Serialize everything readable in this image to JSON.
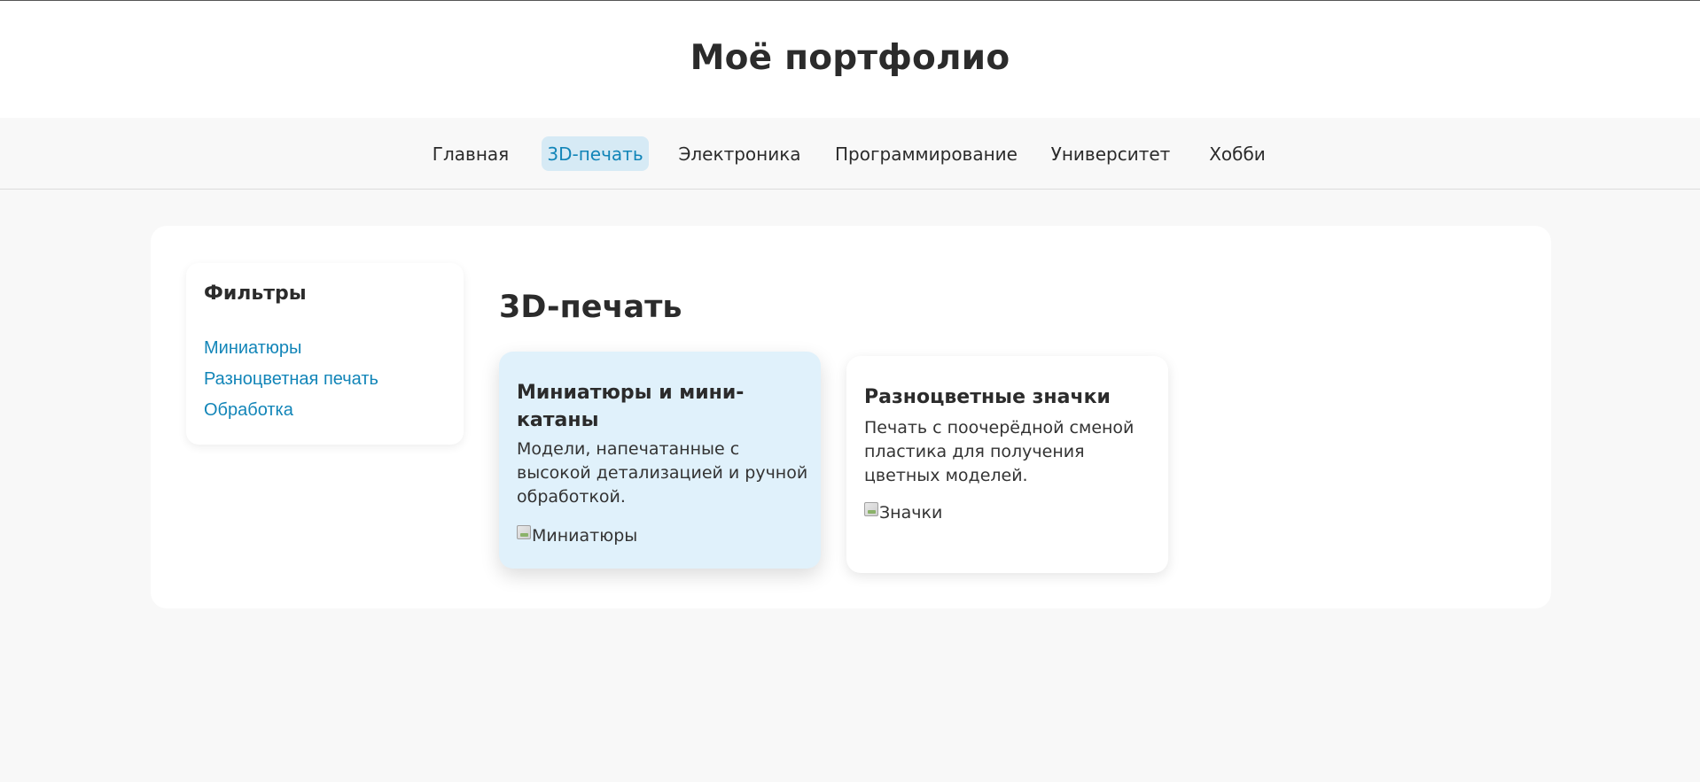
{
  "header": {
    "title": "Моё портфолио"
  },
  "nav": {
    "items": [
      {
        "label": "Главная",
        "active": false
      },
      {
        "label": "3D-печать",
        "active": true
      },
      {
        "label": "Электроника",
        "active": false
      },
      {
        "label": "Программирование",
        "active": false
      },
      {
        "label": "Университет",
        "active": false
      },
      {
        "label": "Хобби",
        "active": false
      }
    ]
  },
  "filters": {
    "title": "Фильтры",
    "links": [
      "Миниатюры",
      "Разноцветная печать",
      "Обработка"
    ]
  },
  "section": {
    "title": "3D-печать"
  },
  "projects": [
    {
      "title": "Миниатюры и мини-катаны",
      "description": "Модели, напечатанные с высокой детализацией и ручной обработкой.",
      "image_alt": "Миниатюры",
      "highlighted": true
    },
    {
      "title": "Разноцветные значки",
      "description": "Печать с поочерёдной сменой пластика для получения цветных моделей.",
      "image_alt": "Значки",
      "highlighted": false
    }
  ],
  "colors": {
    "accent": "#1285b8",
    "active_tab_bg": "#d6eaf5",
    "highlight_card_bg": "#e0f1fb",
    "page_bg": "#f8f8f8"
  }
}
